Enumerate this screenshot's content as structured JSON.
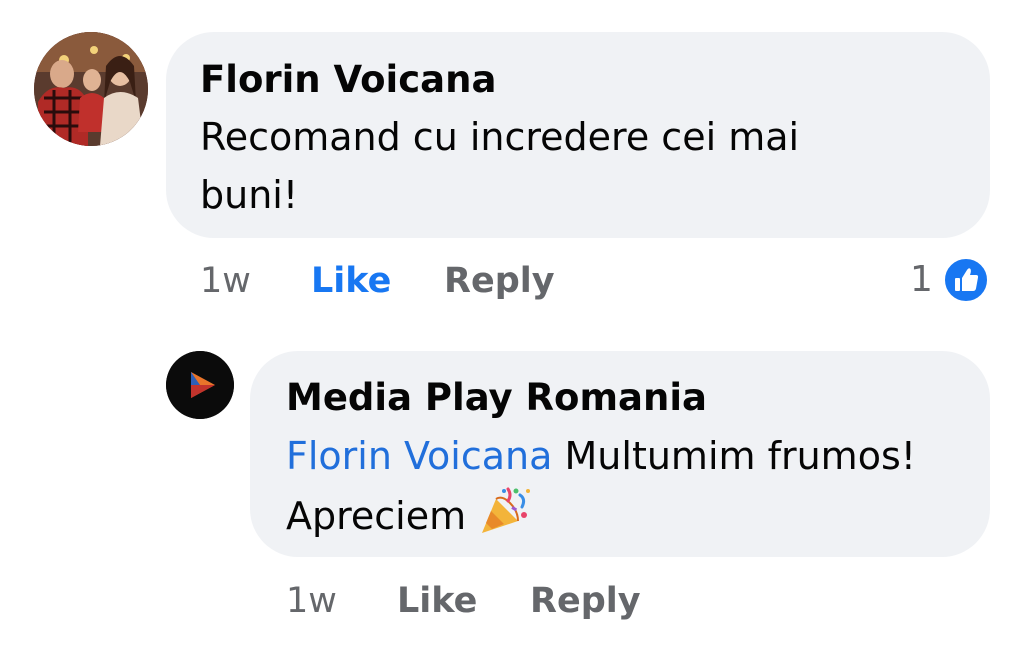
{
  "comments": [
    {
      "author": "Florin Voicana",
      "text": "Recomand cu incredere cei mai buni!",
      "time": "1w",
      "like_label": "Like",
      "reply_label": "Reply",
      "like_active": true,
      "reaction_count": "1"
    },
    {
      "author": "Media Play Romania",
      "mention": "Florin Voicana",
      "text": "Multumim frumos! Apreciem",
      "time": "1w",
      "like_label": "Like",
      "reply_label": "Reply",
      "emoji": "party-popper-emoji"
    }
  ],
  "colors": {
    "bubble": "#f0f2f5",
    "link_blue": "#1877f2",
    "mention_blue": "#216fdb",
    "meta_gray": "#65676b"
  },
  "icons": {
    "reaction": "like-thumbs-up-icon",
    "media_play_logo": "play-triangle-logo-icon"
  }
}
